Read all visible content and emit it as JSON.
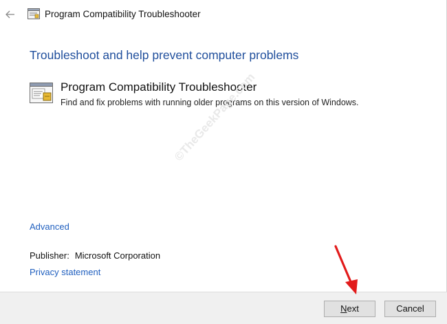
{
  "window": {
    "title": "Program Compatibility Troubleshooter"
  },
  "main": {
    "heading": "Troubleshoot and help prevent computer problems",
    "item": {
      "title": "Program Compatibility Troubleshooter",
      "description": "Find and fix problems with running older programs on this version of Windows."
    },
    "advanced_link": "Advanced",
    "publisher_label": "Publisher:",
    "publisher_value": "Microsoft Corporation",
    "privacy_link": "Privacy statement"
  },
  "watermark": "©TheGeekPage.com",
  "footer": {
    "next_access_key": "N",
    "next_rest": "ext",
    "cancel_label": "Cancel"
  },
  "colors": {
    "heading": "#1f4e9c",
    "link": "#1f5fbf",
    "footer_bg": "#f0f0f0",
    "annotation_arrow": "#e21b1b"
  },
  "icons": {
    "back": "back-arrow-icon",
    "title": "troubleshooter-icon",
    "item": "troubleshooter-icon",
    "annotation": "red-arrow-icon"
  }
}
